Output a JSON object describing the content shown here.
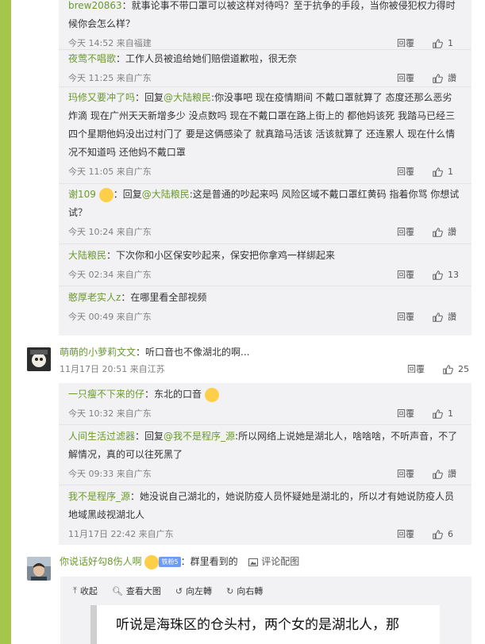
{
  "replies": [
    {
      "user": "brew20863",
      "text": "：就事论事不带口罩可以被这样对待吗？至于抗争的手段，当你被侵犯权力得时候你会怎么样？",
      "time": "今天 14:52 来自福建",
      "reply_label": "回覆",
      "likes": "1"
    },
    {
      "user": "夜莺不唱歌",
      "text": "：工作人员被追给她们赔偿道歉啦，很无奈",
      "time": "今天 11:25 来自广东",
      "reply_label": "回覆",
      "likes": "讚"
    },
    {
      "user": "玛修又要冲了吗",
      "prefix": "：回复",
      "mention": "@大陆粮民",
      "text": ":你没事吧 现在疫情期间 不戴口罩就算了 态度还那么恶劣 炸滴 现在广州天天新增多少 没点数吗 现在不戴口罩在路上街上的 都他妈该死 我踏马已经三四个星期他妈没出过村门了 要是这俩感染了 就真踏马活该 活该就算了 还连累人 现在什么情况不知道吗 还他妈不戴口罩",
      "time": "今天 11:05 来自广东",
      "reply_label": "回覆",
      "likes": "1"
    },
    {
      "user": "谢109",
      "prefix": "：回复",
      "mention": "@大陆粮民",
      "text": ":这是普通的吵起来吗 风险区域不戴口罩红黄码 指着你骂 你想试试？",
      "time": "今天 10:24 来自广东",
      "reply_label": "回覆",
      "likes": "讚"
    },
    {
      "user": "大陆粮民",
      "text": "：下次你和小区保安吵起来，保安把你拿鸡一样綁起来",
      "time": "今天 02:34 来自广东",
      "reply_label": "回覆",
      "likes": "13"
    },
    {
      "user": "憨厚老实人z",
      "text": "：在哪里看全部视频",
      "time": "今天 00:49 来自广东",
      "reply_label": "回覆",
      "likes": "讚"
    }
  ],
  "comment2": {
    "user": "萌萌的小萝莉文文",
    "text": "：听口音也不像湖北的啊...",
    "time": "11月17日 20:51 来自江苏",
    "reply_label": "回覆",
    "likes": "25"
  },
  "replies2": [
    {
      "user": "一只瘦不下来的仔",
      "text": "：东北的口音",
      "time": "今天 10:32 来自广东",
      "reply_label": "回覆",
      "likes": "1"
    },
    {
      "user": "人间生活过滤器",
      "prefix": "：回复",
      "mention": "@我不是程序_源",
      "text": ":所以网络上说她是湖北人，啥啥啥，不听声音，不了解情况，真的可以往死黑了",
      "time": "今天 09:33 来自广东",
      "reply_label": "回覆",
      "likes": "讚"
    },
    {
      "user": "我不是程序_源",
      "text": "：她没说自己湖北的，她说防疫人员怀疑她是湖北的，所以才有她说防疫人员地域黑歧视湖北人",
      "time": "11月17日 22:42 来自广东",
      "reply_label": "回覆",
      "likes": "6"
    }
  ],
  "comment3": {
    "user": "你说话好勾8伤人啊",
    "badge": "铁粉5",
    "text": "：群里看到的",
    "pic_link": "评论配图"
  },
  "picbox": {
    "collapse": "收起",
    "view_large": "查看大图",
    "rotate_left": "向左轉",
    "rotate_right": "向右轉",
    "picture_text": "听说是海珠区的仓头村，两个女的是湖北人，那"
  },
  "colors": {
    "accent_green": "#6a9a2b",
    "left_bar": "#a4c64a",
    "reply_bg": "#f2f2f5"
  },
  "icons": [
    "thumbs-up-icon",
    "image-icon",
    "collapse-icon",
    "magnifier-icon",
    "rotate-left-icon",
    "rotate-right-icon"
  ]
}
